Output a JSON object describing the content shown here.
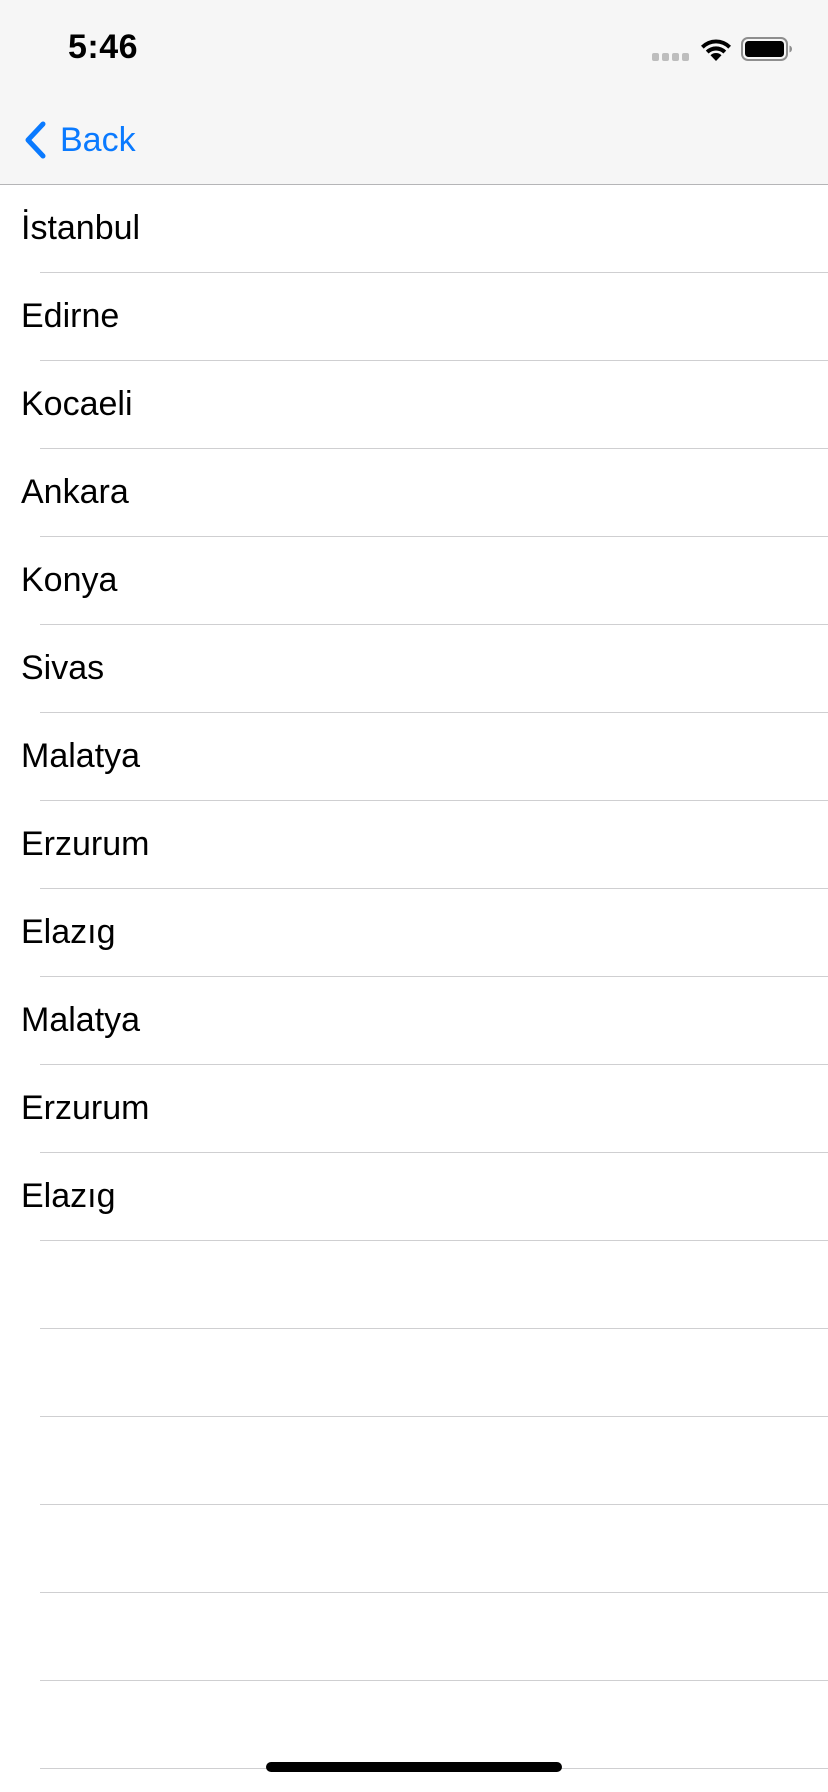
{
  "status_bar": {
    "time": "5:46",
    "icons": [
      "cellular-signal-icon",
      "wifi-icon",
      "battery-icon"
    ]
  },
  "nav_bar": {
    "back_label": "Back",
    "back_icon": "chevron-left-icon",
    "accent_color": "#0a7aff"
  },
  "list": {
    "items": [
      {
        "label": "İstanbul"
      },
      {
        "label": "Edirne"
      },
      {
        "label": "Kocaeli"
      },
      {
        "label": "Ankara"
      },
      {
        "label": "Konya"
      },
      {
        "label": "Sivas"
      },
      {
        "label": "Malatya"
      },
      {
        "label": "Erzurum"
      },
      {
        "label": "Elazıg"
      },
      {
        "label": "Malatya"
      },
      {
        "label": "Erzurum"
      },
      {
        "label": "Elazıg"
      },
      {
        "label": ""
      },
      {
        "label": ""
      },
      {
        "label": ""
      },
      {
        "label": ""
      },
      {
        "label": ""
      },
      {
        "label": ""
      }
    ]
  }
}
